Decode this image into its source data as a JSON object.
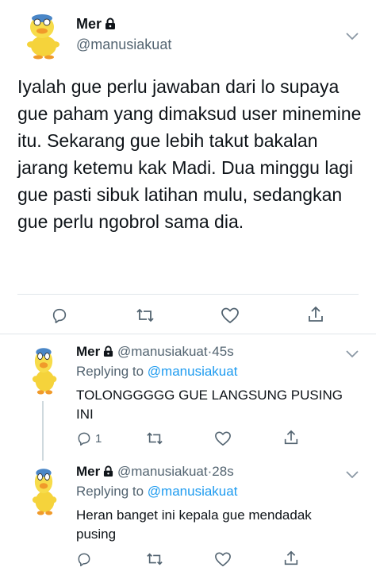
{
  "main_tweet": {
    "name": "Mer",
    "handle": "@manusiakuat",
    "text": "Iyalah gue perlu jawaban dari lo supaya gue paham yang dimaksud user minemine itu. Sekarang gue lebih takut bakalan jarang ketemu kak Madi. Dua minggu lagi gue pasti sibuk latihan mulu, sedangkan gue perlu ngobrol sama dia.",
    "icons": [
      "reply-icon",
      "retweet-icon",
      "like-icon",
      "share-icon",
      "lock-icon",
      "chevron-down-icon"
    ]
  },
  "replies": [
    {
      "name": "Mer",
      "handle": "@manusiakuat",
      "time": "45s",
      "replying_label": "Replying to",
      "replying_to": "@manusiakuat",
      "text": "TOLONGGGGG GUE LANGSUNG PUSING INI",
      "reply_count": "1"
    },
    {
      "name": "Mer",
      "handle": "@manusiakuat",
      "time": "28s",
      "replying_label": "Replying to",
      "replying_to": "@manusiakuat",
      "text": "Heran banget ini kepala gue mendadak pusing",
      "reply_count": ""
    }
  ],
  "colors": {
    "link": "#1d9bf0",
    "muted": "#536471",
    "divider": "#e1e6ea"
  },
  "separator": "·"
}
